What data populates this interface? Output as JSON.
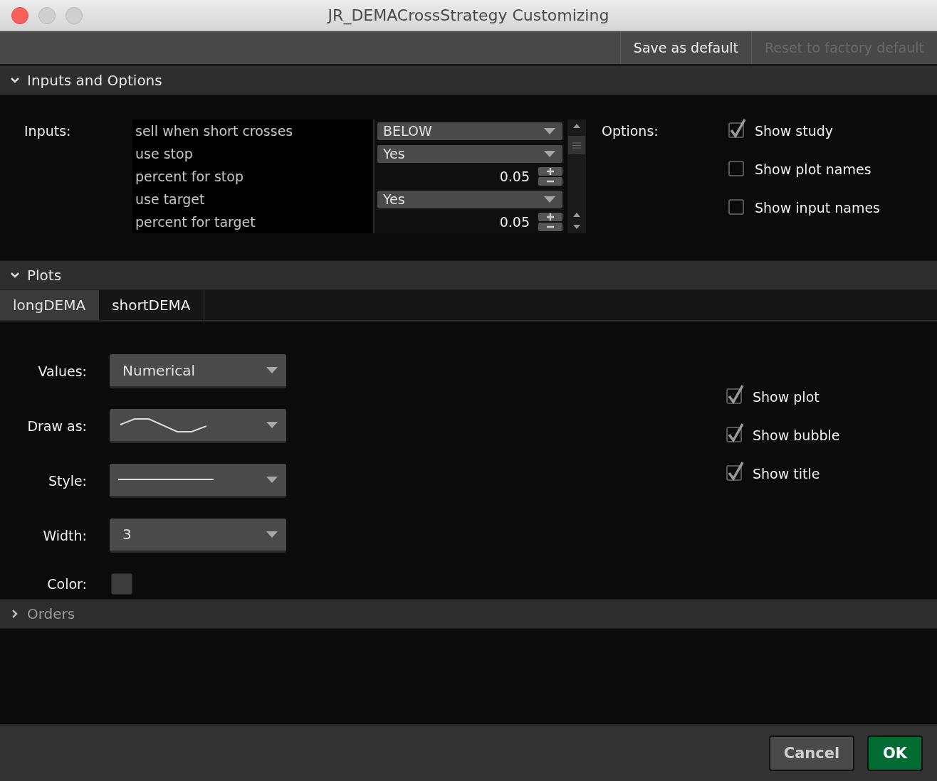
{
  "window": {
    "title": "JR_DEMACrossStrategy Customizing"
  },
  "toolbar": [
    {
      "label": "Save as default",
      "disabled": false
    },
    {
      "label": "Reset to factory default",
      "disabled": true
    }
  ],
  "inputs_section": {
    "title": "Inputs and Options",
    "expanded": true,
    "inputs_label": "Inputs:",
    "inputs": [
      {
        "name": "sell when short crosses",
        "kind": "select",
        "value": "BELOW"
      },
      {
        "name": "use stop",
        "kind": "select",
        "value": "Yes"
      },
      {
        "name": "percent for stop",
        "kind": "spinner",
        "value": "0.05"
      },
      {
        "name": "use target",
        "kind": "select",
        "value": "Yes"
      },
      {
        "name": "percent for target",
        "kind": "spinner",
        "value": "0.05"
      }
    ],
    "options_label": "Options:",
    "options": [
      {
        "label": "Show study",
        "checked": true
      },
      {
        "label": "Show plot names",
        "checked": false
      },
      {
        "label": "Show input names",
        "checked": false
      }
    ]
  },
  "plots_section": {
    "title": "Plots",
    "expanded": true,
    "tabs": [
      {
        "label": "longDEMA",
        "selected": true
      },
      {
        "label": "shortDEMA",
        "selected": false
      }
    ],
    "fields": [
      {
        "label": "Values:",
        "kind": "select",
        "value": "Numerical"
      },
      {
        "label": "Draw as:",
        "kind": "plot-type"
      },
      {
        "label": "Style:",
        "kind": "line-style"
      },
      {
        "label": "Width:",
        "kind": "select",
        "value": "3"
      },
      {
        "label": "Color:",
        "kind": "color",
        "color": "#3c3c3c"
      }
    ],
    "options": [
      {
        "label": "Show plot",
        "checked": true
      },
      {
        "label": "Show bubble",
        "checked": true
      },
      {
        "label": "Show title",
        "checked": true
      }
    ]
  },
  "orders_section": {
    "title": "Orders",
    "expanded": false
  },
  "buttons": [
    {
      "label": "Cancel",
      "kind": "secondary"
    },
    {
      "label": "OK",
      "kind": "primary"
    }
  ]
}
